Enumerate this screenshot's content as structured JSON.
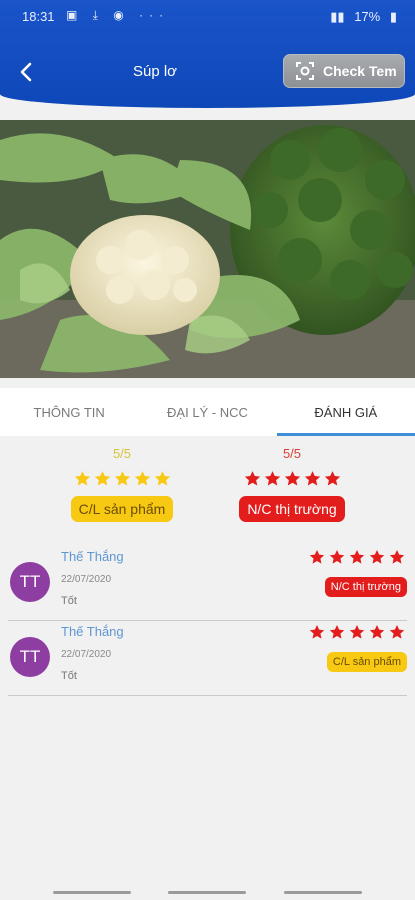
{
  "status_bar": {
    "time": "18:31",
    "battery": "17%"
  },
  "header": {
    "title": "Súp lơ",
    "check_button": "Check Tem"
  },
  "tabs": [
    {
      "label": "THÔNG TIN",
      "active": false
    },
    {
      "label": "ĐẠI LÝ - NCC",
      "active": false
    },
    {
      "label": "ĐÁNH GIÁ",
      "active": true
    }
  ],
  "summary": {
    "quality": {
      "score": "5/5",
      "label": "C/L sản phẩm",
      "rating": 5,
      "color": "#f8c913"
    },
    "market": {
      "score": "5/5",
      "label": "N/C thị trường",
      "rating": 5,
      "color": "#e31c1c"
    }
  },
  "reviews": [
    {
      "initials": "TT",
      "name": "Thế Thắng",
      "date": "22/07/2020",
      "comment": "Tốt",
      "rating": 5,
      "tag": "N/C thị trường",
      "tag_color": "#e31c1c"
    },
    {
      "initials": "TT",
      "name": "Thế Thắng",
      "date": "22/07/2020",
      "comment": "Tốt",
      "rating": 5,
      "tag": "C/L sản phẩm",
      "tag_color": "#f8c913"
    }
  ],
  "colors": {
    "header": "#1a54c9",
    "star_yellow": "#f8c913",
    "star_red": "#e31c1c",
    "tab_indicator": "#3f8ed8",
    "avatar": "#8e3da0"
  }
}
